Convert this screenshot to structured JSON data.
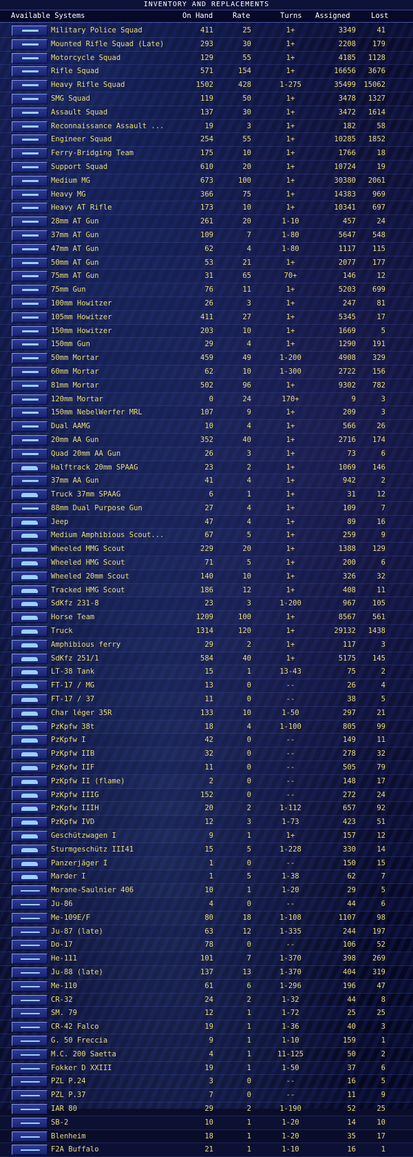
{
  "window": {
    "title": "INVENTORY AND REPLACEMENTS"
  },
  "columns": {
    "system": "Available Systems",
    "on_hand": "On Hand",
    "rate": "Rate",
    "turns": "Turns",
    "assigned": "Assigned",
    "lost": "Lost"
  },
  "rows": [
    {
      "name": "Military Police Squad",
      "on_hand": "411",
      "rate": "25",
      "turns": "1+",
      "assigned": "3349",
      "lost": "41",
      "icon": "infantry-icon"
    },
    {
      "name": "Mounted Rifle Squad (Late)",
      "on_hand": "293",
      "rate": "30",
      "turns": "1+",
      "assigned": "2208",
      "lost": "179",
      "icon": "infantry-icon"
    },
    {
      "name": "Motorcycle Squad",
      "on_hand": "129",
      "rate": "55",
      "turns": "1+",
      "assigned": "4185",
      "lost": "1128",
      "icon": "infantry-icon"
    },
    {
      "name": "Rifle Squad",
      "on_hand": "571",
      "rate": "154",
      "turns": "1+",
      "assigned": "16656",
      "lost": "3676",
      "icon": "infantry-icon"
    },
    {
      "name": "Heavy Rifle Squad",
      "on_hand": "1502",
      "rate": "428",
      "turns": "1-275",
      "assigned": "35499",
      "lost": "15062",
      "icon": "infantry-icon"
    },
    {
      "name": "SMG Squad",
      "on_hand": "119",
      "rate": "50",
      "turns": "1+",
      "assigned": "3478",
      "lost": "1327",
      "icon": "infantry-icon"
    },
    {
      "name": "Assault Squad",
      "on_hand": "137",
      "rate": "30",
      "turns": "1+",
      "assigned": "3472",
      "lost": "1614",
      "icon": "infantry-icon"
    },
    {
      "name": "Reconnaissance Assault ...",
      "on_hand": "19",
      "rate": "3",
      "turns": "1+",
      "assigned": "182",
      "lost": "58",
      "icon": "infantry-icon"
    },
    {
      "name": "Engineer Squad",
      "on_hand": "254",
      "rate": "55",
      "turns": "1+",
      "assigned": "10285",
      "lost": "1852",
      "icon": "infantry-icon"
    },
    {
      "name": "Ferry-Bridging Team",
      "on_hand": "175",
      "rate": "10",
      "turns": "1+",
      "assigned": "1766",
      "lost": "18",
      "icon": "infantry-icon"
    },
    {
      "name": "Support Squad",
      "on_hand": "610",
      "rate": "20",
      "turns": "1+",
      "assigned": "10724",
      "lost": "19",
      "icon": "infantry-icon"
    },
    {
      "name": "Medium MG",
      "on_hand": "673",
      "rate": "100",
      "turns": "1+",
      "assigned": "30380",
      "lost": "2061",
      "icon": "infantry-icon"
    },
    {
      "name": "Heavy MG",
      "on_hand": "366",
      "rate": "75",
      "turns": "1+",
      "assigned": "14383",
      "lost": "969",
      "icon": "infantry-icon"
    },
    {
      "name": "Heavy AT Rifle",
      "on_hand": "173",
      "rate": "10",
      "turns": "1+",
      "assigned": "10341",
      "lost": "697",
      "icon": "infantry-icon"
    },
    {
      "name": "28mm AT Gun",
      "on_hand": "261",
      "rate": "20",
      "turns": "1-10",
      "assigned": "457",
      "lost": "24",
      "icon": "gun-icon"
    },
    {
      "name": "37mm AT Gun",
      "on_hand": "109",
      "rate": "7",
      "turns": "1-80",
      "assigned": "5647",
      "lost": "548",
      "icon": "gun-icon"
    },
    {
      "name": "47mm AT Gun",
      "on_hand": "62",
      "rate": "4",
      "turns": "1-80",
      "assigned": "1117",
      "lost": "115",
      "icon": "gun-icon"
    },
    {
      "name": "50mm AT Gun",
      "on_hand": "53",
      "rate": "21",
      "turns": "1+",
      "assigned": "2077",
      "lost": "177",
      "icon": "gun-icon"
    },
    {
      "name": "75mm AT Gun",
      "on_hand": "31",
      "rate": "65",
      "turns": "70+",
      "assigned": "146",
      "lost": "12",
      "icon": "gun-icon"
    },
    {
      "name": "75mm Gun",
      "on_hand": "76",
      "rate": "11",
      "turns": "1+",
      "assigned": "5203",
      "lost": "699",
      "icon": "gun-icon"
    },
    {
      "name": "100mm Howitzer",
      "on_hand": "26",
      "rate": "3",
      "turns": "1+",
      "assigned": "247",
      "lost": "81",
      "icon": "gun-icon"
    },
    {
      "name": "105mm Howitzer",
      "on_hand": "411",
      "rate": "27",
      "turns": "1+",
      "assigned": "5345",
      "lost": "17",
      "icon": "gun-icon"
    },
    {
      "name": "150mm Howitzer",
      "on_hand": "203",
      "rate": "10",
      "turns": "1+",
      "assigned": "1669",
      "lost": "5",
      "icon": "gun-icon"
    },
    {
      "name": "150mm Gun",
      "on_hand": "29",
      "rate": "4",
      "turns": "1+",
      "assigned": "1290",
      "lost": "191",
      "icon": "gun-icon"
    },
    {
      "name": "50mm Mortar",
      "on_hand": "459",
      "rate": "49",
      "turns": "1-200",
      "assigned": "4908",
      "lost": "329",
      "icon": "mortar-icon"
    },
    {
      "name": "60mm Mortar",
      "on_hand": "62",
      "rate": "10",
      "turns": "1-300",
      "assigned": "2722",
      "lost": "156",
      "icon": "mortar-icon"
    },
    {
      "name": "81mm Mortar",
      "on_hand": "502",
      "rate": "96",
      "turns": "1+",
      "assigned": "9302",
      "lost": "782",
      "icon": "mortar-icon"
    },
    {
      "name": "120mm Mortar",
      "on_hand": "0",
      "rate": "24",
      "turns": "170+",
      "assigned": "9",
      "lost": "3",
      "icon": "mortar-icon"
    },
    {
      "name": "150mm NebelWerfer MRL",
      "on_hand": "107",
      "rate": "9",
      "turns": "1+",
      "assigned": "209",
      "lost": "3",
      "icon": "gun-icon"
    },
    {
      "name": "Dual AAMG",
      "on_hand": "10",
      "rate": "4",
      "turns": "1+",
      "assigned": "566",
      "lost": "26",
      "icon": "gun-icon"
    },
    {
      "name": "20mm AA Gun",
      "on_hand": "352",
      "rate": "40",
      "turns": "1+",
      "assigned": "2716",
      "lost": "174",
      "icon": "gun-icon"
    },
    {
      "name": "Quad 20mm AA Gun",
      "on_hand": "26",
      "rate": "3",
      "turns": "1+",
      "assigned": "73",
      "lost": "6",
      "icon": "gun-icon"
    },
    {
      "name": "Halftrack 20mm SPAAG",
      "on_hand": "23",
      "rate": "2",
      "turns": "1+",
      "assigned": "1069",
      "lost": "146",
      "icon": "vehicle-icon"
    },
    {
      "name": "37mm AA Gun",
      "on_hand": "41",
      "rate": "4",
      "turns": "1+",
      "assigned": "942",
      "lost": "2",
      "icon": "gun-icon"
    },
    {
      "name": "Truck 37mm SPAAG",
      "on_hand": "6",
      "rate": "1",
      "turns": "1+",
      "assigned": "31",
      "lost": "12",
      "icon": "vehicle-icon"
    },
    {
      "name": "88mm Dual Purpose Gun",
      "on_hand": "27",
      "rate": "4",
      "turns": "1+",
      "assigned": "109",
      "lost": "7",
      "icon": "gun-icon"
    },
    {
      "name": "Jeep",
      "on_hand": "47",
      "rate": "4",
      "turns": "1+",
      "assigned": "89",
      "lost": "16",
      "icon": "vehicle-icon"
    },
    {
      "name": "Medium Amphibious Scout...",
      "on_hand": "67",
      "rate": "5",
      "turns": "1+",
      "assigned": "259",
      "lost": "9",
      "icon": "vehicle-icon"
    },
    {
      "name": "Wheeled MMG Scout",
      "on_hand": "229",
      "rate": "20",
      "turns": "1+",
      "assigned": "1388",
      "lost": "129",
      "icon": "vehicle-icon"
    },
    {
      "name": "Wheeled HMG Scout",
      "on_hand": "71",
      "rate": "5",
      "turns": "1+",
      "assigned": "200",
      "lost": "6",
      "icon": "vehicle-icon"
    },
    {
      "name": "Wheeled 20mm Scout",
      "on_hand": "140",
      "rate": "10",
      "turns": "1+",
      "assigned": "326",
      "lost": "32",
      "icon": "vehicle-icon"
    },
    {
      "name": "Tracked HMG Scout",
      "on_hand": "186",
      "rate": "12",
      "turns": "1+",
      "assigned": "408",
      "lost": "11",
      "icon": "vehicle-icon"
    },
    {
      "name": "SdKfz 231-8",
      "on_hand": "23",
      "rate": "3",
      "turns": "1-200",
      "assigned": "967",
      "lost": "105",
      "icon": "vehicle-icon"
    },
    {
      "name": "Horse Team",
      "on_hand": "1209",
      "rate": "100",
      "turns": "1+",
      "assigned": "8567",
      "lost": "561",
      "icon": "horse-icon"
    },
    {
      "name": "Truck",
      "on_hand": "1314",
      "rate": "120",
      "turns": "1+",
      "assigned": "29132",
      "lost": "1438",
      "icon": "vehicle-icon"
    },
    {
      "name": "Amphibious ferry",
      "on_hand": "29",
      "rate": "2",
      "turns": "1+",
      "assigned": "117",
      "lost": "3",
      "icon": "vehicle-icon"
    },
    {
      "name": "SdKfz 251/1",
      "on_hand": "584",
      "rate": "40",
      "turns": "1+",
      "assigned": "5175",
      "lost": "145",
      "icon": "vehicle-icon"
    },
    {
      "name": "LT-38 Tank",
      "on_hand": "15",
      "rate": "1",
      "turns": "13-43",
      "assigned": "75",
      "lost": "2",
      "icon": "tank-icon"
    },
    {
      "name": "FT-17 / MG",
      "on_hand": "13",
      "rate": "0",
      "turns": "--",
      "assigned": "26",
      "lost": "4",
      "icon": "tank-icon"
    },
    {
      "name": "FT-17 / 37",
      "on_hand": "11",
      "rate": "0",
      "turns": "--",
      "assigned": "38",
      "lost": "5",
      "icon": "tank-icon"
    },
    {
      "name": "Char léger 35R",
      "on_hand": "133",
      "rate": "10",
      "turns": "1-50",
      "assigned": "297",
      "lost": "21",
      "icon": "tank-icon"
    },
    {
      "name": "PzKpfw 38t",
      "on_hand": "18",
      "rate": "4",
      "turns": "1-100",
      "assigned": "805",
      "lost": "99",
      "icon": "tank-icon"
    },
    {
      "name": "PzKpfw I",
      "on_hand": "42",
      "rate": "0",
      "turns": "--",
      "assigned": "149",
      "lost": "11",
      "icon": "tank-icon"
    },
    {
      "name": "PzKpfw IIB",
      "on_hand": "32",
      "rate": "0",
      "turns": "--",
      "assigned": "278",
      "lost": "32",
      "icon": "tank-icon"
    },
    {
      "name": "PzKpfw IIF",
      "on_hand": "11",
      "rate": "0",
      "turns": "--",
      "assigned": "505",
      "lost": "79",
      "icon": "tank-icon"
    },
    {
      "name": "PzKpfw II (flame)",
      "on_hand": "2",
      "rate": "0",
      "turns": "--",
      "assigned": "148",
      "lost": "17",
      "icon": "tank-icon"
    },
    {
      "name": "PzKpfw IIIG",
      "on_hand": "152",
      "rate": "0",
      "turns": "--",
      "assigned": "272",
      "lost": "24",
      "icon": "tank-icon"
    },
    {
      "name": "PzKpfw IIIH",
      "on_hand": "20",
      "rate": "2",
      "turns": "1-112",
      "assigned": "657",
      "lost": "92",
      "icon": "tank-icon"
    },
    {
      "name": "PzKpfw IVD",
      "on_hand": "12",
      "rate": "3",
      "turns": "1-73",
      "assigned": "423",
      "lost": "51",
      "icon": "tank-icon"
    },
    {
      "name": "Geschützwagen I",
      "on_hand": "9",
      "rate": "1",
      "turns": "1+",
      "assigned": "157",
      "lost": "12",
      "icon": "tank-icon"
    },
    {
      "name": "Sturmgeschütz III41",
      "on_hand": "15",
      "rate": "5",
      "turns": "1-228",
      "assigned": "330",
      "lost": "14",
      "icon": "tank-icon"
    },
    {
      "name": "Panzerjäger I",
      "on_hand": "1",
      "rate": "0",
      "turns": "--",
      "assigned": "150",
      "lost": "15",
      "icon": "tank-icon"
    },
    {
      "name": "Marder I",
      "on_hand": "1",
      "rate": "5",
      "turns": "1-38",
      "assigned": "62",
      "lost": "7",
      "icon": "tank-icon"
    },
    {
      "name": "Morane-Saulnier 406",
      "on_hand": "10",
      "rate": "1",
      "turns": "1-20",
      "assigned": "29",
      "lost": "5",
      "icon": "aircraft-icon"
    },
    {
      "name": "Ju-86",
      "on_hand": "4",
      "rate": "0",
      "turns": "--",
      "assigned": "44",
      "lost": "6",
      "icon": "aircraft-icon"
    },
    {
      "name": "Me-109E/F",
      "on_hand": "80",
      "rate": "18",
      "turns": "1-108",
      "assigned": "1107",
      "lost": "98",
      "icon": "aircraft-icon"
    },
    {
      "name": "Ju-87 (late)",
      "on_hand": "63",
      "rate": "12",
      "turns": "1-335",
      "assigned": "244",
      "lost": "197",
      "icon": "aircraft-icon"
    },
    {
      "name": "Do-17",
      "on_hand": "78",
      "rate": "0",
      "turns": "--",
      "assigned": "106",
      "lost": "52",
      "icon": "aircraft-icon"
    },
    {
      "name": "He-111",
      "on_hand": "101",
      "rate": "7",
      "turns": "1-370",
      "assigned": "398",
      "lost": "269",
      "icon": "aircraft-icon"
    },
    {
      "name": "Ju-88 (late)",
      "on_hand": "137",
      "rate": "13",
      "turns": "1-370",
      "assigned": "404",
      "lost": "319",
      "icon": "aircraft-icon"
    },
    {
      "name": "Me-110",
      "on_hand": "61",
      "rate": "6",
      "turns": "1-296",
      "assigned": "196",
      "lost": "47",
      "icon": "aircraft-icon"
    },
    {
      "name": "CR-32",
      "on_hand": "24",
      "rate": "2",
      "turns": "1-32",
      "assigned": "44",
      "lost": "8",
      "icon": "aircraft-icon"
    },
    {
      "name": "SM. 79",
      "on_hand": "12",
      "rate": "1",
      "turns": "1-72",
      "assigned": "25",
      "lost": "25",
      "icon": "aircraft-icon"
    },
    {
      "name": "CR-42 Falco",
      "on_hand": "19",
      "rate": "1",
      "turns": "1-36",
      "assigned": "40",
      "lost": "3",
      "icon": "aircraft-icon"
    },
    {
      "name": "G. 50 Freccia",
      "on_hand": "9",
      "rate": "1",
      "turns": "1-10",
      "assigned": "159",
      "lost": "1",
      "icon": "aircraft-icon"
    },
    {
      "name": "M.C. 200 Saetta",
      "on_hand": "4",
      "rate": "1",
      "turns": "11-125",
      "assigned": "50",
      "lost": "2",
      "icon": "aircraft-icon"
    },
    {
      "name": "Fokker D XXIII",
      "on_hand": "19",
      "rate": "1",
      "turns": "1-50",
      "assigned": "37",
      "lost": "6",
      "icon": "aircraft-icon"
    },
    {
      "name": "PZL P.24",
      "on_hand": "3",
      "rate": "0",
      "turns": "--",
      "assigned": "16",
      "lost": "5",
      "icon": "aircraft-icon"
    },
    {
      "name": "PZL P.37",
      "on_hand": "7",
      "rate": "0",
      "turns": "--",
      "assigned": "11",
      "lost": "9",
      "icon": "aircraft-icon"
    },
    {
      "name": "IAR 80",
      "on_hand": "29",
      "rate": "2",
      "turns": "1-190",
      "assigned": "52",
      "lost": "25",
      "icon": "aircraft-icon"
    },
    {
      "name": "SB-2",
      "on_hand": "10",
      "rate": "1",
      "turns": "1-20",
      "assigned": "14",
      "lost": "10",
      "icon": "aircraft-icon"
    },
    {
      "name": "Blenheim",
      "on_hand": "18",
      "rate": "1",
      "turns": "1-20",
      "assigned": "35",
      "lost": "17",
      "icon": "aircraft-icon"
    },
    {
      "name": "F2A Buffalo",
      "on_hand": "21",
      "rate": "1",
      "turns": "1-10",
      "assigned": "16",
      "lost": "1",
      "icon": "aircraft-icon"
    }
  ]
}
